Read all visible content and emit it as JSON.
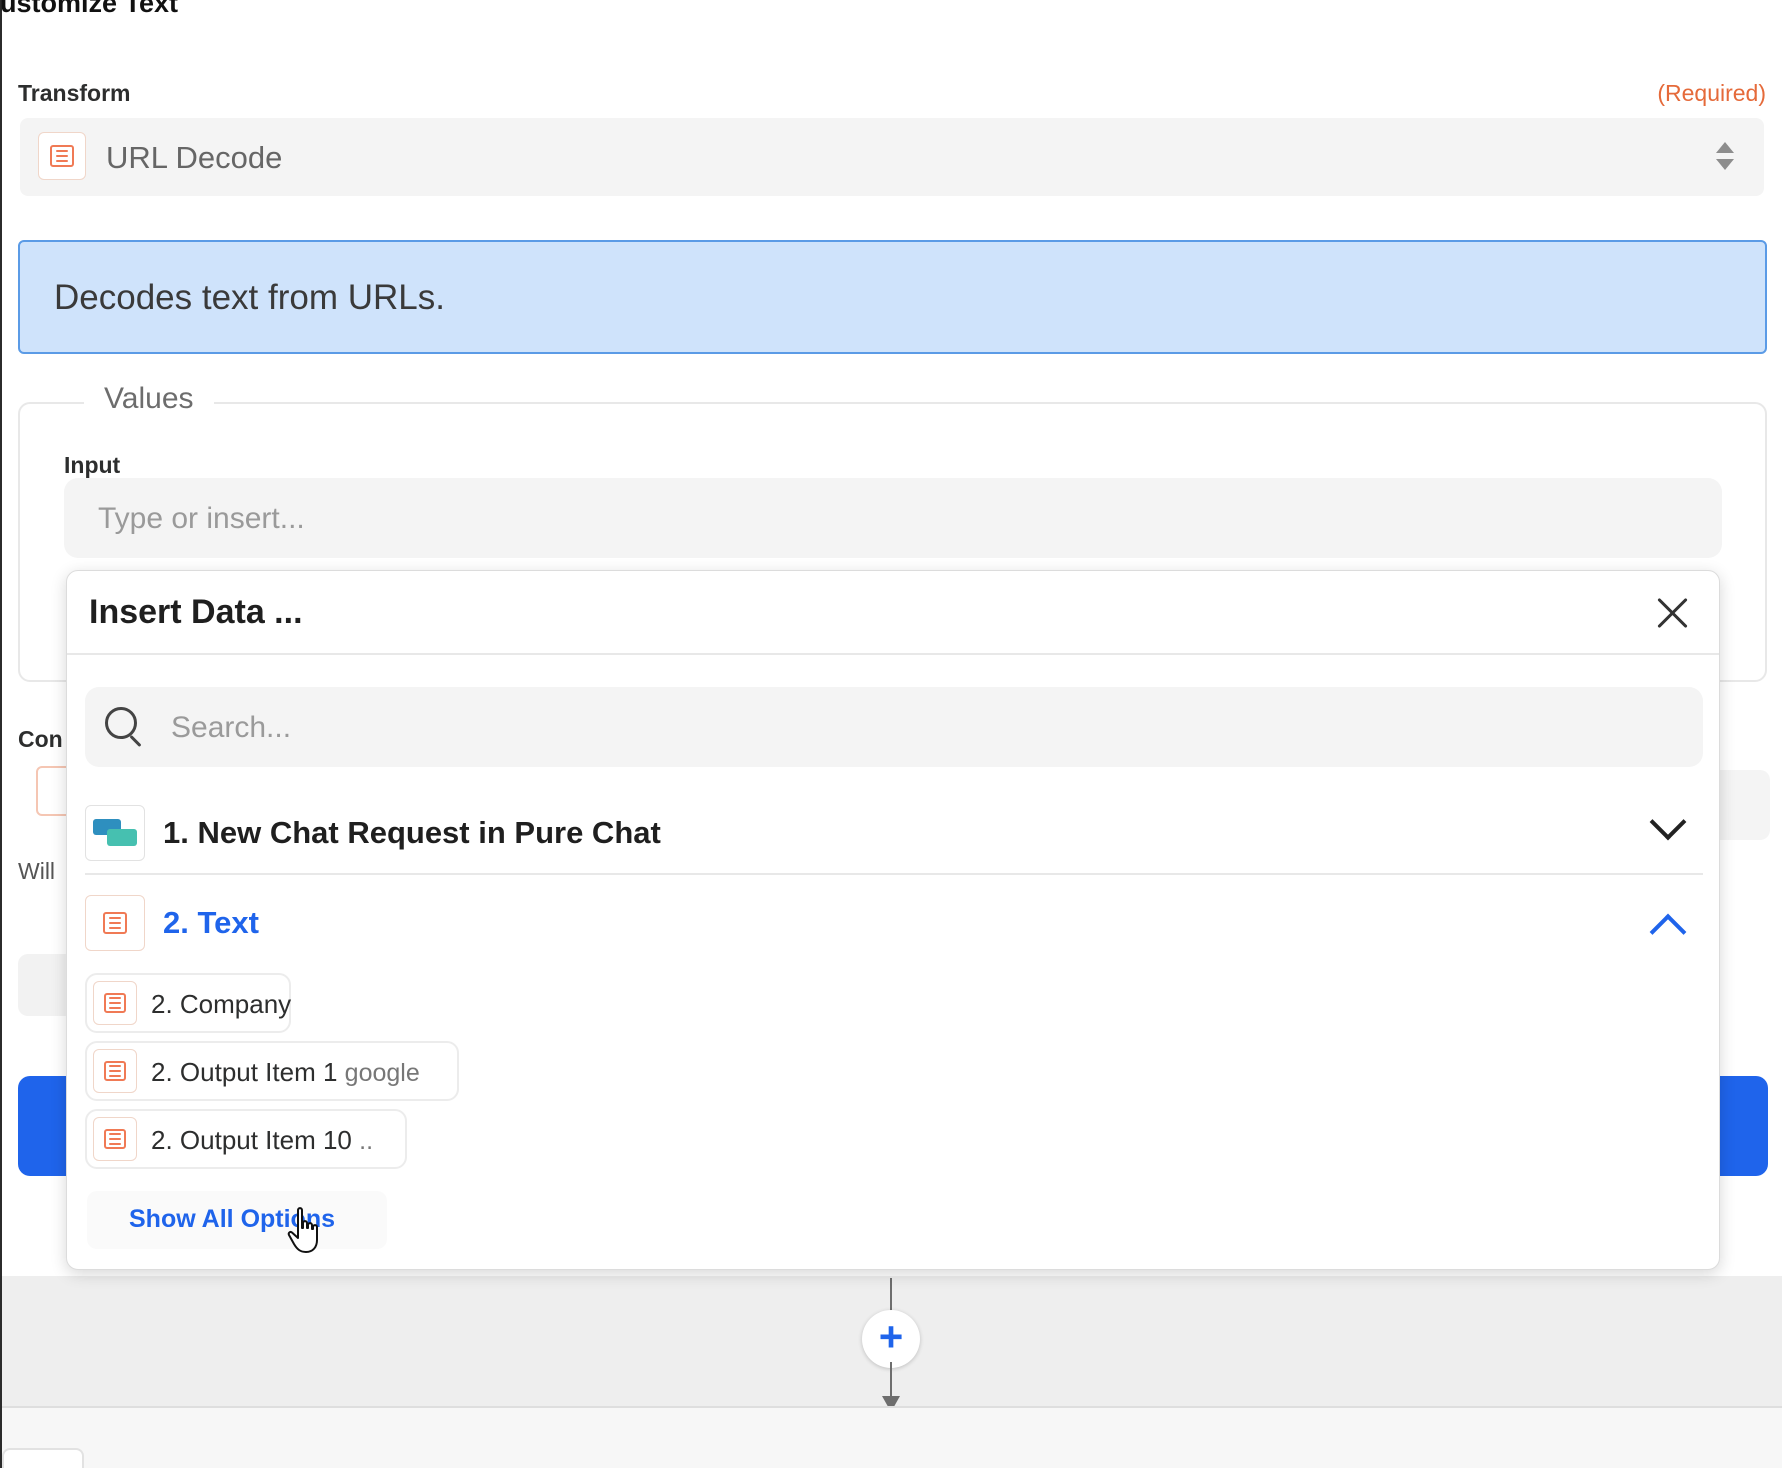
{
  "page": {
    "title": "ustomize Text"
  },
  "transform": {
    "label": "Transform",
    "required": "(Required)",
    "selected": "URL Decode",
    "info": "Decodes text from URLs."
  },
  "values": {
    "legend": "Values",
    "input_label": "Input",
    "input_placeholder": "Type or insert..."
  },
  "background": {
    "con_label": "Con",
    "will_label": "Will"
  },
  "insert_data": {
    "title": "Insert Data ...",
    "search_placeholder": "Search...",
    "groups": [
      {
        "label": "1. New Chat Request in Pure Chat",
        "icon": "pure-chat-icon",
        "expanded": false
      },
      {
        "label": "2. Text",
        "icon": "text-formatter-icon",
        "expanded": true
      }
    ],
    "options": [
      {
        "label": "2. Company",
        "sample": ""
      },
      {
        "label": "2. Output Item 1",
        "sample": "google"
      },
      {
        "label": "2. Output Item 10",
        "sample": ".."
      }
    ],
    "show_all": "Show All Options"
  },
  "colors": {
    "accent": "#1f64eb",
    "required": "#e56a3a",
    "info_bg": "#cfe3fb",
    "info_border": "#5b9be6",
    "app_orange": "#f07a55"
  }
}
